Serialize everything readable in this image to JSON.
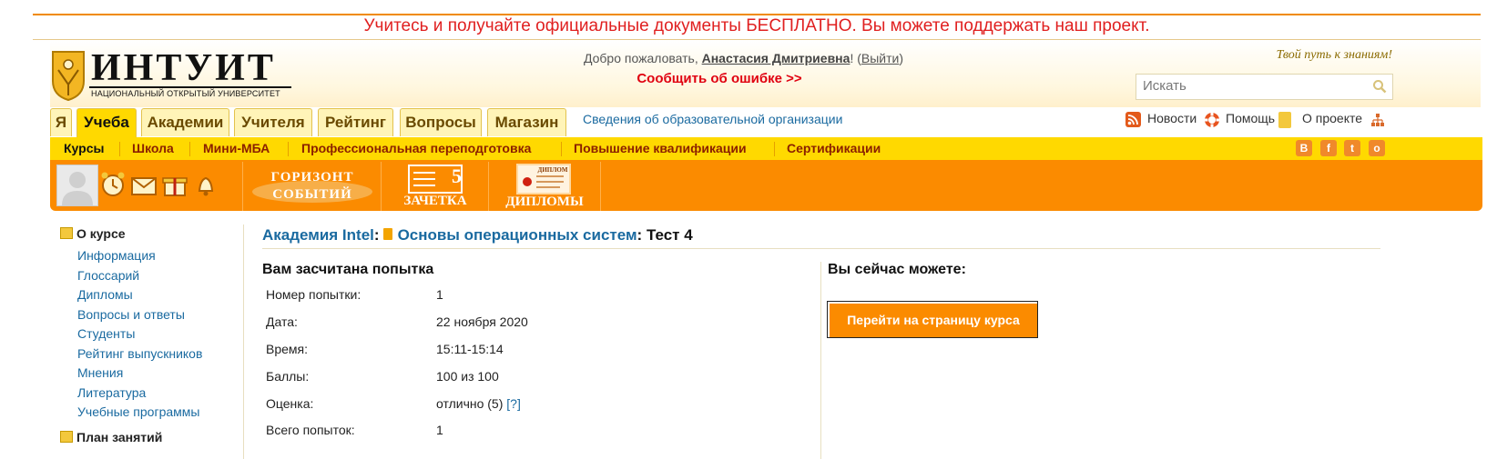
{
  "banner": {
    "text": "Учитесь и получайте официальные документы БЕСПЛАТНО. Вы можете поддержать наш проект."
  },
  "logo": {
    "title": "ИНТУИТ",
    "subtitle": "НАЦИОНАЛЬНЫЙ ОТКРЫТЫЙ УНИВЕРСИТЕТ"
  },
  "header": {
    "welcome_prefix": "Добро пожаловать, ",
    "user_name": "Анастасия Дмитриевна",
    "welcome_mid": "! (",
    "logout_label": "Выйти",
    "welcome_end": ")",
    "report_error": "Сообщить об ошибке >>",
    "slogan": "Твой путь к знаниям!"
  },
  "search": {
    "placeholder": "Искать",
    "value": ""
  },
  "tabs": [
    {
      "label": "Я",
      "active": false
    },
    {
      "label": "Учеба",
      "active": true
    },
    {
      "label": "Академии",
      "active": false
    },
    {
      "label": "Учителя",
      "active": false
    },
    {
      "label": "Рейтинг",
      "active": false
    },
    {
      "label": "Вопросы",
      "active": false
    },
    {
      "label": "Магазин",
      "active": false
    }
  ],
  "org_link": "Сведения об образовательной организации",
  "right_links": {
    "news": "Новости",
    "help": "Помощь",
    "about": "О проекте"
  },
  "subnav": [
    {
      "label": "Курсы",
      "active": true
    },
    {
      "label": "Школа",
      "active": false
    },
    {
      "label": "Мини-МБА",
      "active": false
    },
    {
      "label": "Профессиональная переподготовка",
      "active": false
    },
    {
      "label": "Повышение квалификации",
      "active": false
    },
    {
      "label": "Сертификации",
      "active": false
    }
  ],
  "social": [
    "В",
    "f",
    "t",
    "о"
  ],
  "orange_bar": {
    "horizon_line1": "ГОРИЗОНТ",
    "horizon_line2": "СОБЫТИЙ",
    "gradebook_number": "5",
    "gradebook_label": "ЗАЧЕТКА",
    "diploma_badge": "ДИПЛОМ",
    "diplomas_label": "ДИПЛОМЫ"
  },
  "sidebar": {
    "section1": "О курсе",
    "links": [
      "Информация",
      "Глоссарий",
      "Дипломы",
      "Вопросы и ответы",
      "Студенты",
      "Рейтинг выпускников",
      "Мнения",
      "Литература",
      "Учебные программы"
    ],
    "section2": "План занятий"
  },
  "breadcrumb": {
    "academy": "Академия Intel",
    "sep1": ":",
    "course": "Основы операционных систем",
    "sep2": ": ",
    "test": "Тест 4"
  },
  "attempt": {
    "title": "Вам засчитана попытка",
    "rows": [
      {
        "label": "Номер попытки:",
        "value": "1"
      },
      {
        "label": "Дата:",
        "value": "22 ноября 2020"
      },
      {
        "label": "Время:",
        "value": "15:11-15:14"
      },
      {
        "label": "Баллы:",
        "value": "100 из 100"
      },
      {
        "label": "Оценка:",
        "value": "отлично (5)"
      },
      {
        "label": "Всего попыток:",
        "value": "1"
      }
    ],
    "grade_hint": "[?]"
  },
  "actions": {
    "title": "Вы сейчас можете:",
    "go_course": "Перейти на страницу курса"
  },
  "colors": {
    "accent_orange": "#fb8b00",
    "nav_yellow": "#ffd900",
    "link_blue": "#1a6aa0",
    "banner_red": "#e02020"
  }
}
